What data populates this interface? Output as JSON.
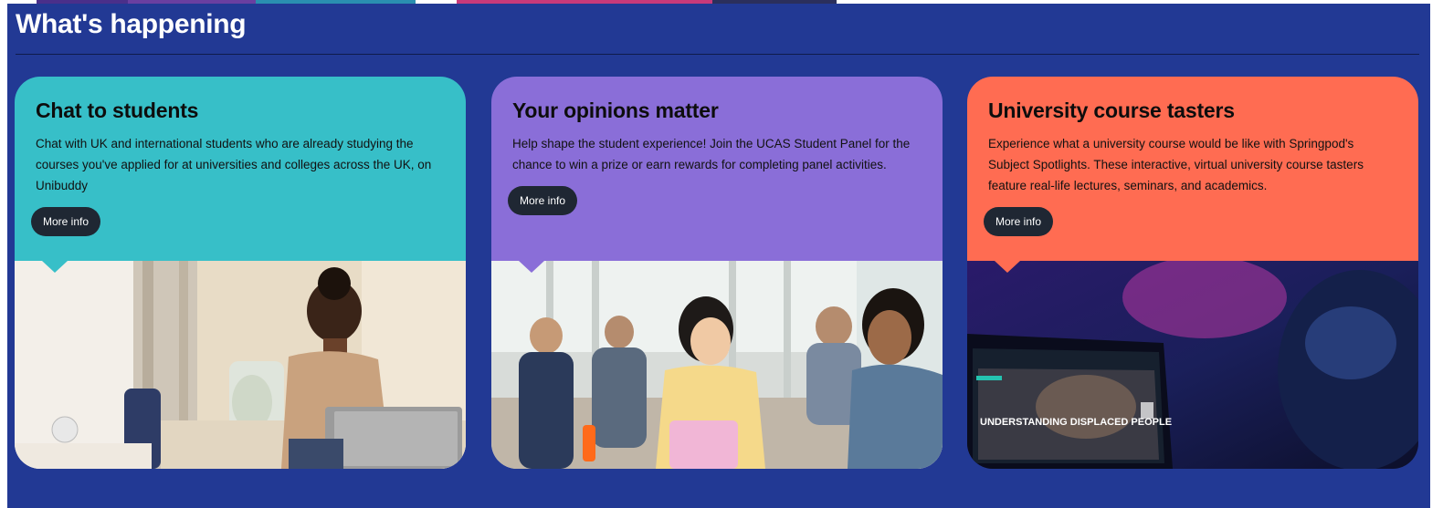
{
  "section": {
    "heading": "What's happening"
  },
  "cards": [
    {
      "title": "Chat to students",
      "description": "Chat with UK and international students who are already studying the courses you've applied for at universities and colleges across the UK, on Unibuddy",
      "button": "More info",
      "color": "#37bfc8"
    },
    {
      "title": "Your opinions matter",
      "description": "Help shape the student experience! Join the UCAS Student Panel for the chance to win a prize or earn rewards for completing panel activities.",
      "button": "More info",
      "color": "#8a6ed8"
    },
    {
      "title": "University course tasters",
      "description": "Experience what a university course would be like with Springpod's Subject Spotlights. These interactive, virtual university course tasters feature real-life lectures, seminars, and academics.",
      "button": "More info",
      "color": "#ff6c52"
    }
  ],
  "photo_text": {
    "laptop_screen": "UNDERSTANDING DISPLACED PEOPLE"
  },
  "colors": {
    "section_bg": "#223994",
    "button_bg": "#1f2733"
  }
}
